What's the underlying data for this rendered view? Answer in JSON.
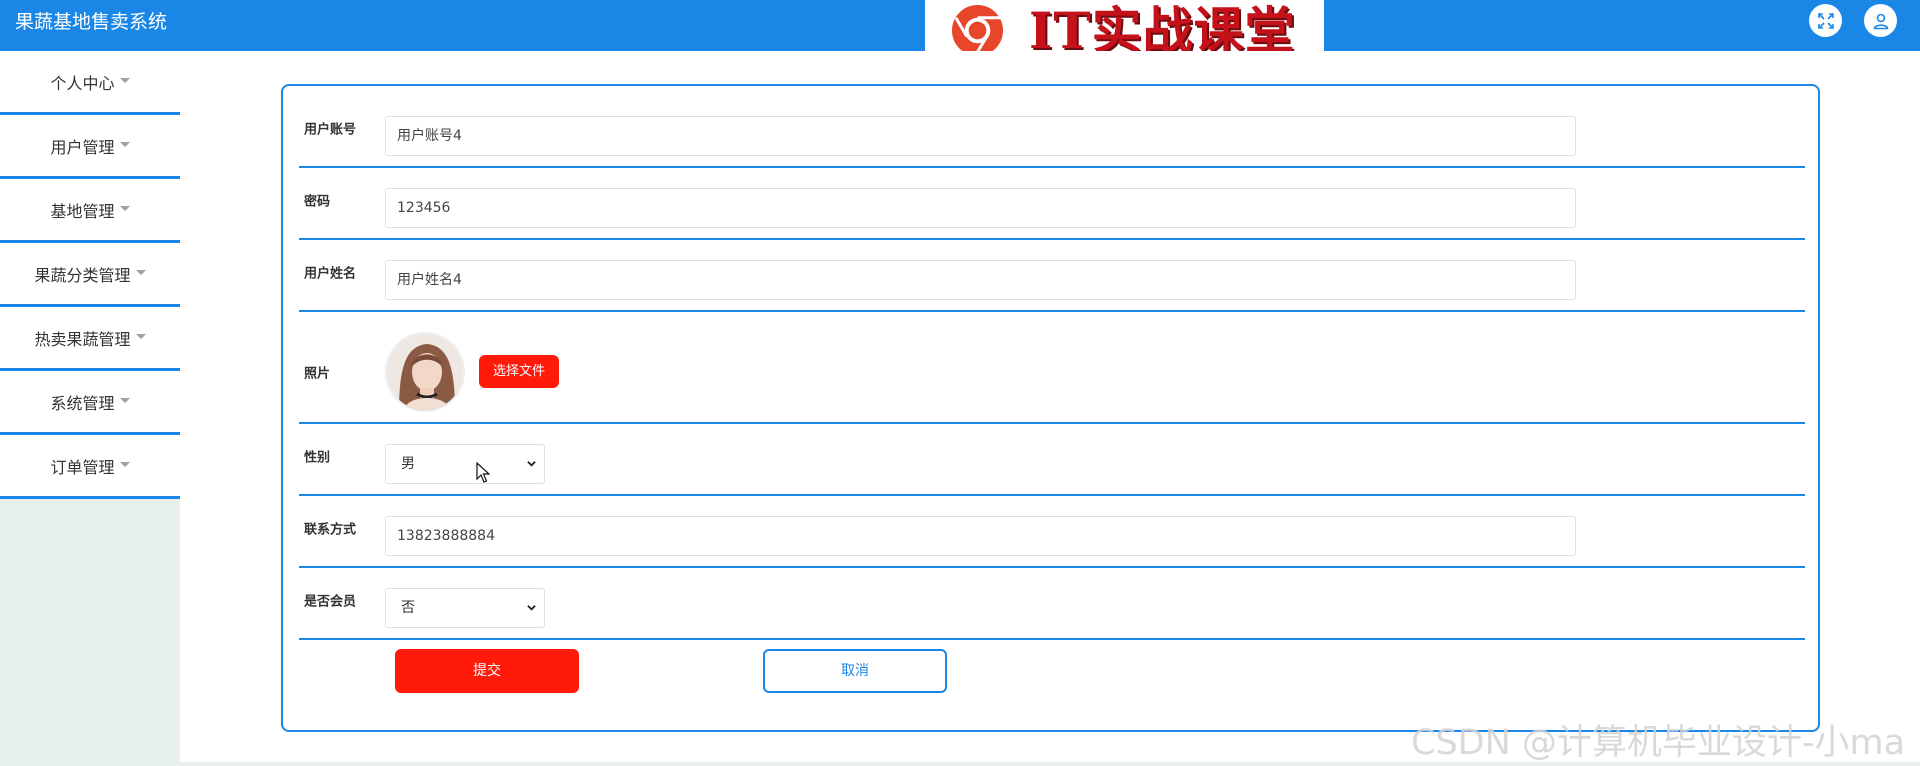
{
  "app": {
    "title": "果蔬基地售卖系统"
  },
  "banner": {
    "text": "IT实战课堂",
    "logo_icon": "chrome-like-logo-icon"
  },
  "header_icons": {
    "fullscreen": "fullscreen-icon",
    "user": "user-icon"
  },
  "sidebar": {
    "items": [
      {
        "label": "个人中心"
      },
      {
        "label": "用户管理"
      },
      {
        "label": "基地管理"
      },
      {
        "label": "果蔬分类管理"
      },
      {
        "label": "热卖果蔬管理"
      },
      {
        "label": "系统管理"
      },
      {
        "label": "订单管理"
      }
    ]
  },
  "form": {
    "account": {
      "label": "用户账号",
      "value": "用户账号4"
    },
    "password": {
      "label": "密码",
      "value": "123456"
    },
    "name": {
      "label": "用户姓名",
      "value": "用户姓名4"
    },
    "photo": {
      "label": "照片",
      "button": "选择文件"
    },
    "gender": {
      "label": "性别",
      "selected": "男"
    },
    "phone": {
      "label": "联系方式",
      "value": "13823888884"
    },
    "member": {
      "label": "是否会员",
      "selected": "否"
    },
    "submit": "提交",
    "cancel": "取消"
  },
  "watermark": "CSDN @计算机毕业设计-小ma",
  "colors": {
    "primary": "#1a87e6",
    "danger": "#ff1a0a",
    "sidebar_bg": "#e6efec"
  }
}
